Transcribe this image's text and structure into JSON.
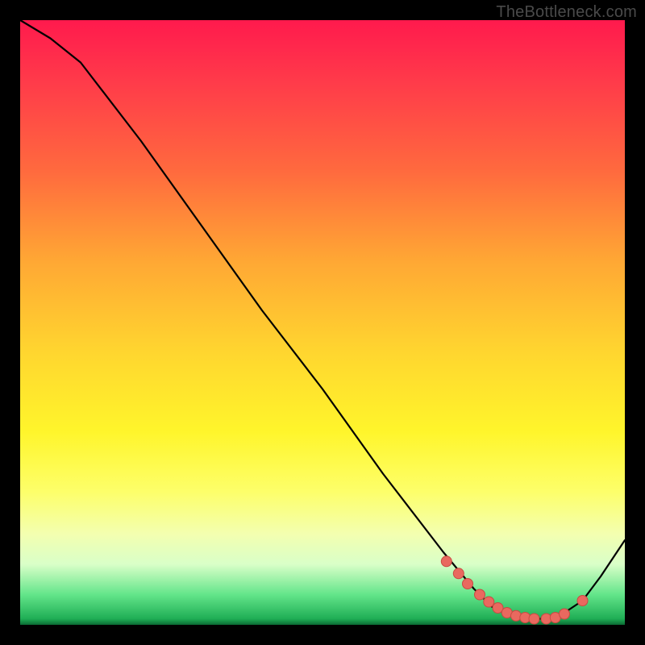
{
  "watermark": "TheBottleneck.com",
  "chart_data": {
    "type": "line",
    "title": "",
    "xlabel": "",
    "ylabel": "",
    "xlim": [
      0,
      100
    ],
    "ylim": [
      0,
      100
    ],
    "series": [
      {
        "name": "curve",
        "x": [
          0,
          5,
          10,
          20,
          30,
          40,
          50,
          60,
          70,
          75,
          78,
          80,
          82,
          85,
          88,
          90,
          93,
          96,
          100
        ],
        "y": [
          100,
          97,
          93,
          80,
          66,
          52,
          39,
          25,
          12,
          6,
          3,
          2,
          1,
          1,
          1,
          2,
          4,
          8,
          14
        ]
      }
    ],
    "markers": {
      "name": "data-points",
      "x": [
        70.5,
        72.5,
        74,
        76,
        77.5,
        79,
        80.5,
        82,
        83.5,
        85,
        87,
        88.5,
        90,
        93
      ],
      "y": [
        10.5,
        8.5,
        6.8,
        5,
        3.8,
        2.8,
        2,
        1.5,
        1.2,
        1,
        1,
        1.2,
        1.8,
        4.0
      ]
    },
    "colors": {
      "curve": "#000000",
      "marker_fill": "#e9695f",
      "marker_stroke": "#c94a42"
    }
  }
}
